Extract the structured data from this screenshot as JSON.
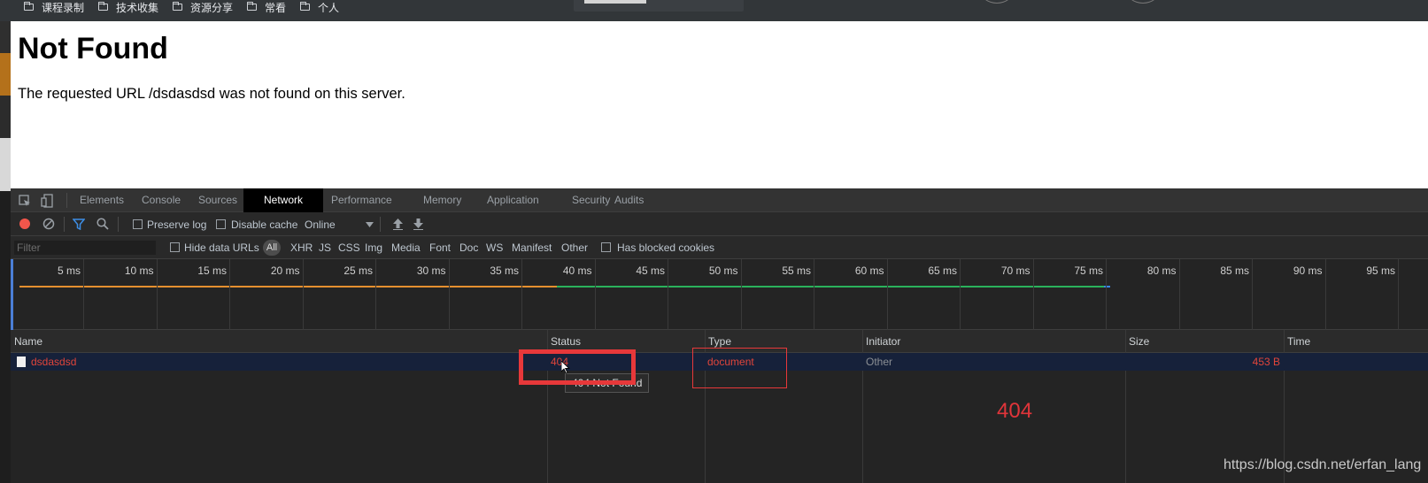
{
  "bookmarks": [
    {
      "label": "课程录制"
    },
    {
      "label": "技术收集"
    },
    {
      "label": "资源分享"
    },
    {
      "label": "常看"
    },
    {
      "label": "个人"
    }
  ],
  "page": {
    "title": "Not Found",
    "message": "The requested URL /dsdasdsd was not found on this server."
  },
  "devtools": {
    "tabs": [
      "Elements",
      "Console",
      "Sources",
      "Network",
      "Performance",
      "Memory",
      "Application",
      "Security",
      "Audits"
    ],
    "active_tab": "Network",
    "toolbar": {
      "preserve_log": "Preserve log",
      "disable_cache": "Disable cache",
      "throttle": "Online"
    },
    "filter": {
      "placeholder": "Filter",
      "hide_data_urls": "Hide data URLs",
      "all": "All",
      "types": [
        "XHR",
        "JS",
        "CSS",
        "Img",
        "Media",
        "Font",
        "Doc",
        "WS",
        "Manifest",
        "Other"
      ],
      "has_blocked_cookies": "Has blocked cookies"
    },
    "timeline_ticks": [
      "5 ms",
      "10 ms",
      "15 ms",
      "20 ms",
      "25 ms",
      "30 ms",
      "35 ms",
      "40 ms",
      "45 ms",
      "50 ms",
      "55 ms",
      "60 ms",
      "65 ms",
      "70 ms",
      "75 ms",
      "80 ms",
      "85 ms",
      "90 ms",
      "95 ms"
    ],
    "columns": [
      "Name",
      "Status",
      "Type",
      "Initiator",
      "Size",
      "Time"
    ],
    "request": {
      "name": "dsdasdsd",
      "status": "404",
      "type": "document",
      "initiator": "Other",
      "size": "453 B"
    },
    "tooltip": "404 Not Found"
  },
  "annotation": "404",
  "watermark": "https://blog.csdn.net/erfan_lang",
  "colors": {
    "error_red": "#e0453a",
    "annotation_red": "#e7383a",
    "active_tab_bg": "#000000",
    "selected_row": "#16213a"
  }
}
